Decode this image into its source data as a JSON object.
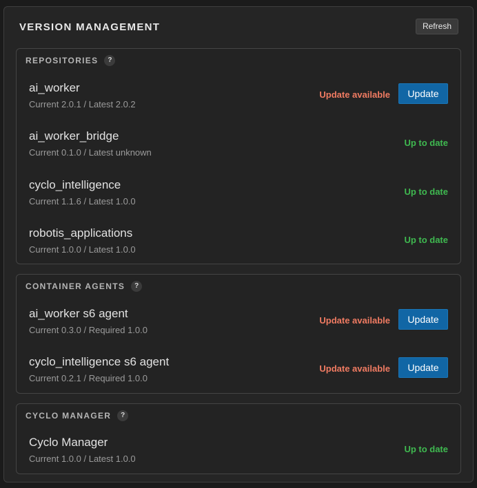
{
  "title": "VERSION MANAGEMENT",
  "refresh_label": "Refresh",
  "sections": [
    {
      "title": "REPOSITORIES",
      "help": "?",
      "rows": [
        {
          "name": "ai_worker",
          "meta": "Current 2.0.1 / Latest 2.0.2",
          "status": "Update available",
          "action": "Update"
        },
        {
          "name": "ai_worker_bridge",
          "meta": "Current 0.1.0 / Latest unknown",
          "status": "Up to date"
        },
        {
          "name": "cyclo_intelligence",
          "meta": "Current 1.1.6 / Latest 1.0.0",
          "status": "Up to date"
        },
        {
          "name": "robotis_applications",
          "meta": "Current 1.0.0 / Latest 1.0.0",
          "status": "Up to date"
        }
      ]
    },
    {
      "title": "CONTAINER AGENTS",
      "help": "?",
      "rows": [
        {
          "name": "ai_worker s6 agent",
          "meta": "Current 0.3.0 / Required 1.0.0",
          "status": "Update available",
          "action": "Update"
        },
        {
          "name": "cyclo_intelligence s6 agent",
          "meta": "Current 0.2.1 / Required 1.0.0",
          "status": "Update available",
          "action": "Update"
        }
      ]
    },
    {
      "title": "CYCLO MANAGER",
      "help": "?",
      "rows": [
        {
          "name": "Cyclo Manager",
          "meta": "Current 1.0.0 / Latest 1.0.0",
          "status": "Up to date"
        }
      ]
    }
  ],
  "colors": {
    "update_available": "#f07b62",
    "up_to_date": "#3fb950",
    "update_button": "#1166a5"
  }
}
